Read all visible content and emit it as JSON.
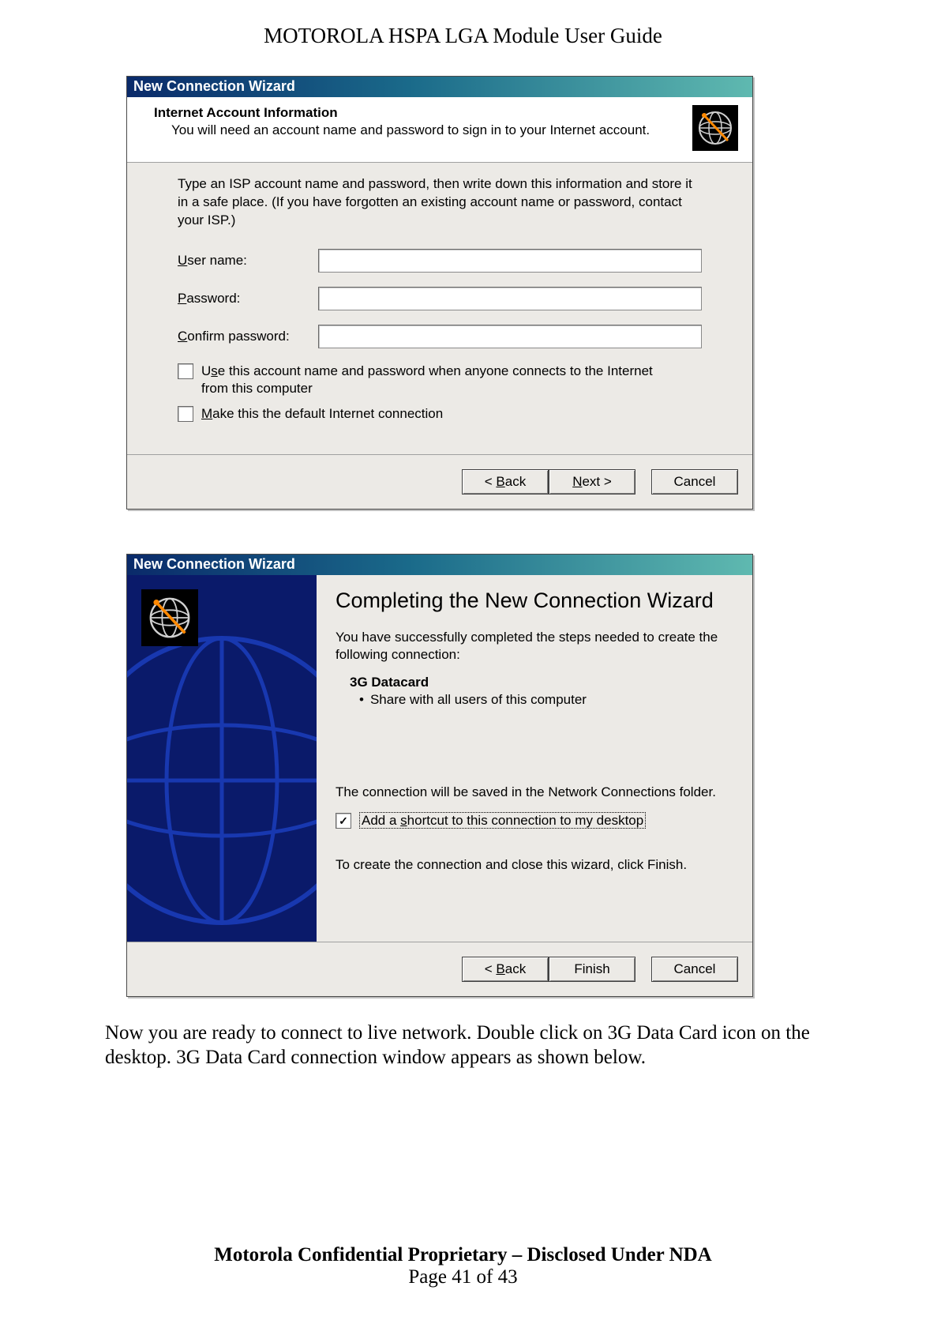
{
  "doc_header": "MOTOROLA HSPA LGA Module User Guide",
  "dialog1": {
    "title": "New Connection Wizard",
    "header_title": "Internet Account Information",
    "header_sub": "You will need an account name and password to sign in to your Internet account.",
    "desc": "Type an ISP account name and password, then write down this information and store it in a safe place. (If you have forgotten an existing account name or password, contact your ISP.)",
    "labels": {
      "username": "User name:",
      "password": "Password:",
      "confirm": "Confirm password:"
    },
    "values": {
      "username": "",
      "password": "",
      "confirm": ""
    },
    "checks": {
      "cb1_pre": "U",
      "cb1_u": "s",
      "cb1_post": "e this account  name and password when anyone connects to the Internet from this computer",
      "cb2_u": "M",
      "cb2_post": "ake this the default Internet connection"
    },
    "buttons": {
      "back": "< Back",
      "next": "Next >",
      "cancel": "Cancel"
    }
  },
  "dialog2": {
    "title": "New Connection Wizard",
    "heading": "Completing the New Connection Wizard",
    "line1": "You have successfully completed the steps needed to create the following connection:",
    "conn_name": "3G Datacard",
    "bullet": "Share with all users of this computer",
    "line2": "The connection will be saved in the Network Connections folder.",
    "cb_pre": "Add a ",
    "cb_u": "s",
    "cb_post": "hortcut to this connection to my desktop",
    "line3": "To create the connection and close this wizard, click Finish.",
    "buttons": {
      "back": "< Back",
      "finish": "Finish",
      "cancel": "Cancel"
    }
  },
  "body_paragraph": "Now you are ready to connect to live network. Double click on 3G Data Card icon on the desktop. 3G Data Card connection window appears as shown below.",
  "footer": {
    "bold": "Motorola Confidential Proprietary – Disclosed Under NDA",
    "page": "Page 41 of 43"
  }
}
